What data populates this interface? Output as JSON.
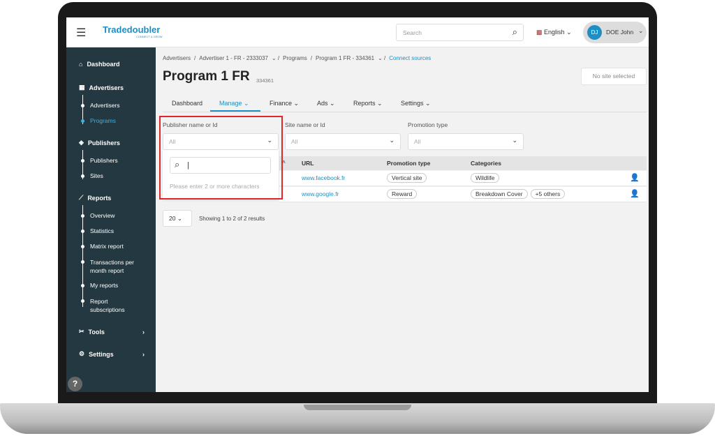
{
  "header": {
    "logo": "Tradedoubler",
    "logo_tagline": "CONNECT & GROW",
    "search_placeholder": "Search",
    "language": "English",
    "avatar_initials": "DJ",
    "user_name": "DOE John"
  },
  "sidebar": {
    "dashboard": "Dashboard",
    "advertisers": "Advertisers",
    "advertisers_items": [
      "Advertisers",
      "Programs"
    ],
    "publishers": "Publishers",
    "publishers_items": [
      "Publishers",
      "Sites"
    ],
    "reports": "Reports",
    "reports_items": [
      "Overview",
      "Statistics",
      "Matrix report",
      "Transactions per month report",
      "My reports",
      "Report subscriptions"
    ],
    "tools": "Tools",
    "settings": "Settings",
    "help": "?"
  },
  "breadcrumb": [
    "Advertisers",
    "Advertiser 1 - FR - 2333037",
    "Programs",
    "Program 1 FR - 334361",
    "Connect sources"
  ],
  "page": {
    "title": "Program 1 FR",
    "id": "334361",
    "site_selector": "No site selected"
  },
  "tabs": [
    "Dashboard",
    "Manage",
    "Finance",
    "Ads",
    "Reports",
    "Settings"
  ],
  "active_tab": "Manage",
  "filters": {
    "publisher_label": "Publisher name or Id",
    "publisher_value": "All",
    "site_label": "Site name or Id",
    "site_value": "All",
    "promo_label": "Promotion type",
    "promo_value": "All"
  },
  "dropdown": {
    "search_value": "",
    "hint": "Please enter 2 or more characters"
  },
  "table": {
    "headers": [
      "URL",
      "Promotion type",
      "Categories"
    ],
    "rows": [
      {
        "url": "www.facebook.fr",
        "promotion": "Vertical site",
        "categories": [
          "Wildlife"
        ]
      },
      {
        "url": "www.google.fr",
        "promotion": "Reward",
        "categories": [
          "Breakdown Cover",
          "+5 others"
        ]
      }
    ]
  },
  "pagination": {
    "page_size": "20",
    "summary": "Showing 1 to 2 of 2 results"
  },
  "colors": {
    "accent": "#1d8fc4",
    "sidebar": "#233840",
    "highlight": "#e0262b"
  }
}
